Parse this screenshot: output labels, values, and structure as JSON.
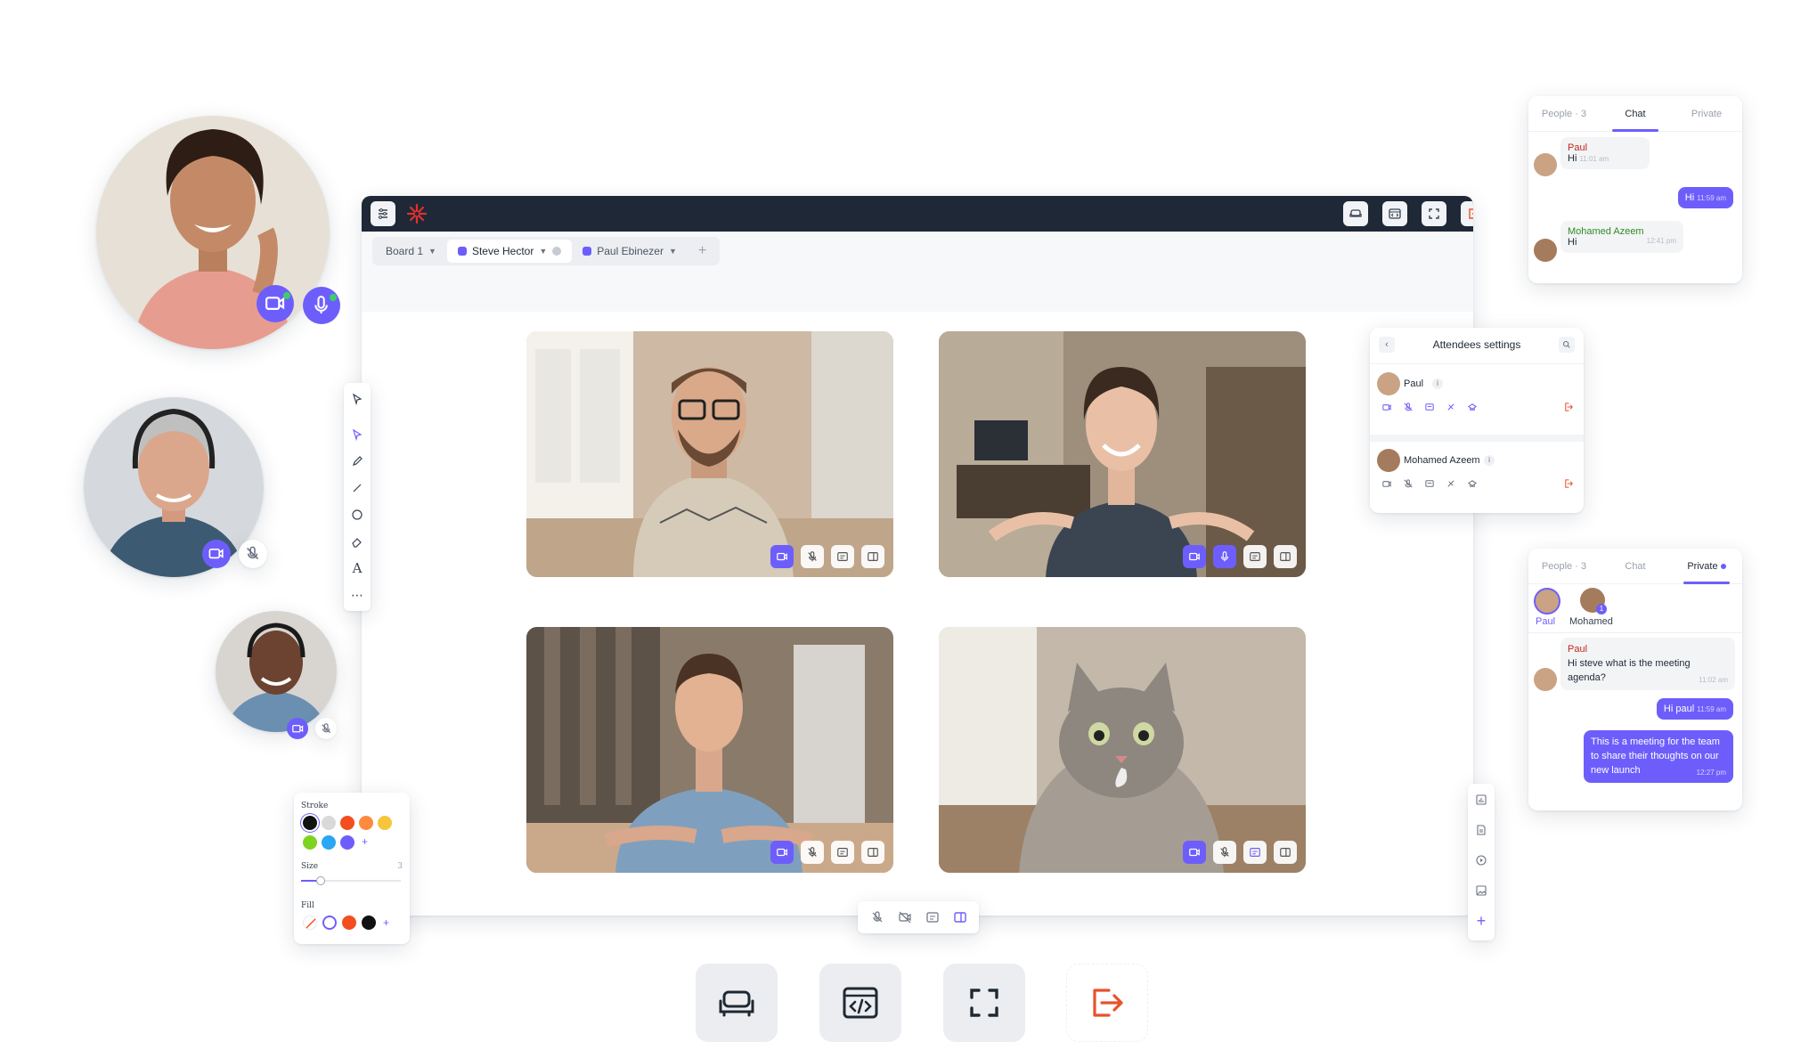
{
  "window": {
    "tabs": [
      {
        "label": "Board 1"
      },
      {
        "label": "Steve Hector"
      },
      {
        "label": "Paul Ebinezer"
      }
    ],
    "tab_add": "+"
  },
  "stroke_panel": {
    "stroke_label": "Stroke",
    "size_label": "Size",
    "size_value": "3",
    "fill_label": "Fill",
    "add": "+",
    "size_fraction": 0.2,
    "stroke_colors": [
      "#111111",
      "#d9d9d9",
      "#f24e1e",
      "#ff8a3d",
      "#f5c53a",
      "#7ed321",
      "#2aa6f5",
      "#6d5efc"
    ],
    "fill_colors": [
      "#f24e1e",
      "#111111"
    ]
  },
  "side_toolbar": {
    "add": "+"
  },
  "chat_panel": {
    "tabs": [
      "People · 3",
      "Chat",
      "Private"
    ],
    "active_tab": "Chat",
    "messages": [
      {
        "name": "Paul",
        "text": "Hi",
        "time": "11:01 am"
      },
      {
        "text": "Hi",
        "time": "11:59 am"
      },
      {
        "name": "Mohamed Azeem",
        "text": "Hi",
        "time": "12:41 pm"
      }
    ]
  },
  "attendees_panel": {
    "title": "Attendees settings",
    "attendees": [
      {
        "name": "Paul",
        "info": "i"
      },
      {
        "name": "Mohamed Azeem",
        "info": "i"
      }
    ]
  },
  "private_panel": {
    "tabs": [
      "People · 3",
      "Chat",
      "Private"
    ],
    "active_tab": "Private",
    "recipients": [
      {
        "name": "Paul"
      },
      {
        "name": "Mohamed",
        "badge": "1"
      }
    ],
    "messages": [
      {
        "name": "Paul",
        "text": "Hi steve what is the meeting agenda?",
        "time": "11:02 am"
      },
      {
        "text": "Hi paul",
        "time": "11:59 am"
      },
      {
        "text": "This is a meeting for the team to share their thoughts on our new launch",
        "time": "12:27 pm"
      }
    ]
  },
  "colors": {
    "accent": "#6d5efc",
    "topbar": "#1f2837",
    "danger": "#e8522a",
    "online": "#3ccf6a"
  }
}
